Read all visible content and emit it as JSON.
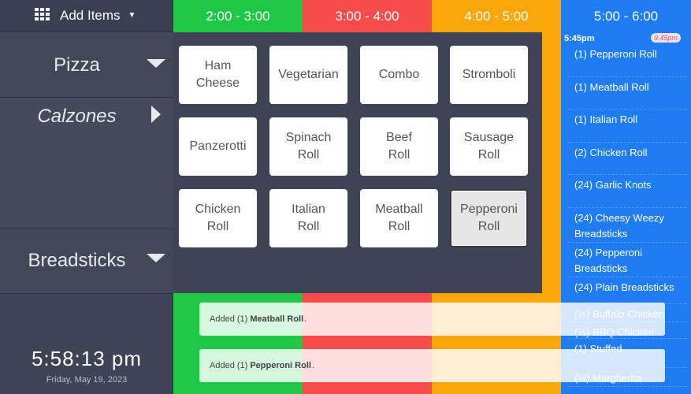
{
  "sidebar": {
    "add_items_label": "Add Items",
    "categories": [
      {
        "name": "Pizza"
      },
      {
        "name": "Calzones"
      },
      {
        "name": "Breadsticks"
      }
    ],
    "clock_time": "5:58:13 pm",
    "clock_date": "Friday, May 19, 2023"
  },
  "time_slots": [
    {
      "label": "2:00 - 3:00",
      "color": "#1ec846"
    },
    {
      "label": "3:00 - 4:00",
      "color": "#f74c4c"
    },
    {
      "label": "4:00 - 5:00",
      "color": "#f9a60a"
    },
    {
      "label": "5:00 - 6:00",
      "color": "#1f7cf2"
    }
  ],
  "menu_items": [
    {
      "label": "Ham\nCheese",
      "selected": false
    },
    {
      "label": "Vegetarian",
      "selected": false
    },
    {
      "label": "Combo",
      "selected": false
    },
    {
      "label": "Stromboli",
      "selected": false
    },
    {
      "label": "Panzerotti",
      "selected": false
    },
    {
      "label": "Spinach\nRoll",
      "selected": false
    },
    {
      "label": "Beef\nRoll",
      "selected": false
    },
    {
      "label": "Sausage\nRoll",
      "selected": false
    },
    {
      "label": "Chicken\nRoll",
      "selected": false
    },
    {
      "label": "Italian\nRoll",
      "selected": false
    },
    {
      "label": "Meatball\nRoll",
      "selected": false
    },
    {
      "label": "Pepperoni\nRoll",
      "selected": true
    }
  ],
  "order": {
    "time": "5:45pm",
    "badge": "9.45pm",
    "items": [
      "(1) Pepperoni Roll",
      "(1) Meatball Roll",
      "(1) Italian Roll",
      "(2) Chicken Roll",
      "(24) Garlic Knots",
      "(24) Cheesy Weezy Breadsticks",
      "(24) Pepperoni Breadsticks",
      "(24) Plain Breadsticks",
      "(½) Buffalo Chicken",
      "(½) BBQ Chicken",
      "(1) Stuffed",
      "(½) Margherita"
    ]
  },
  "toasts": [
    {
      "prefix": "Added (1)",
      "item": "Meatball Roll",
      "suffix": "."
    },
    {
      "prefix": "Added (1)",
      "item": "Pepperoni Roll",
      "suffix": "."
    }
  ]
}
